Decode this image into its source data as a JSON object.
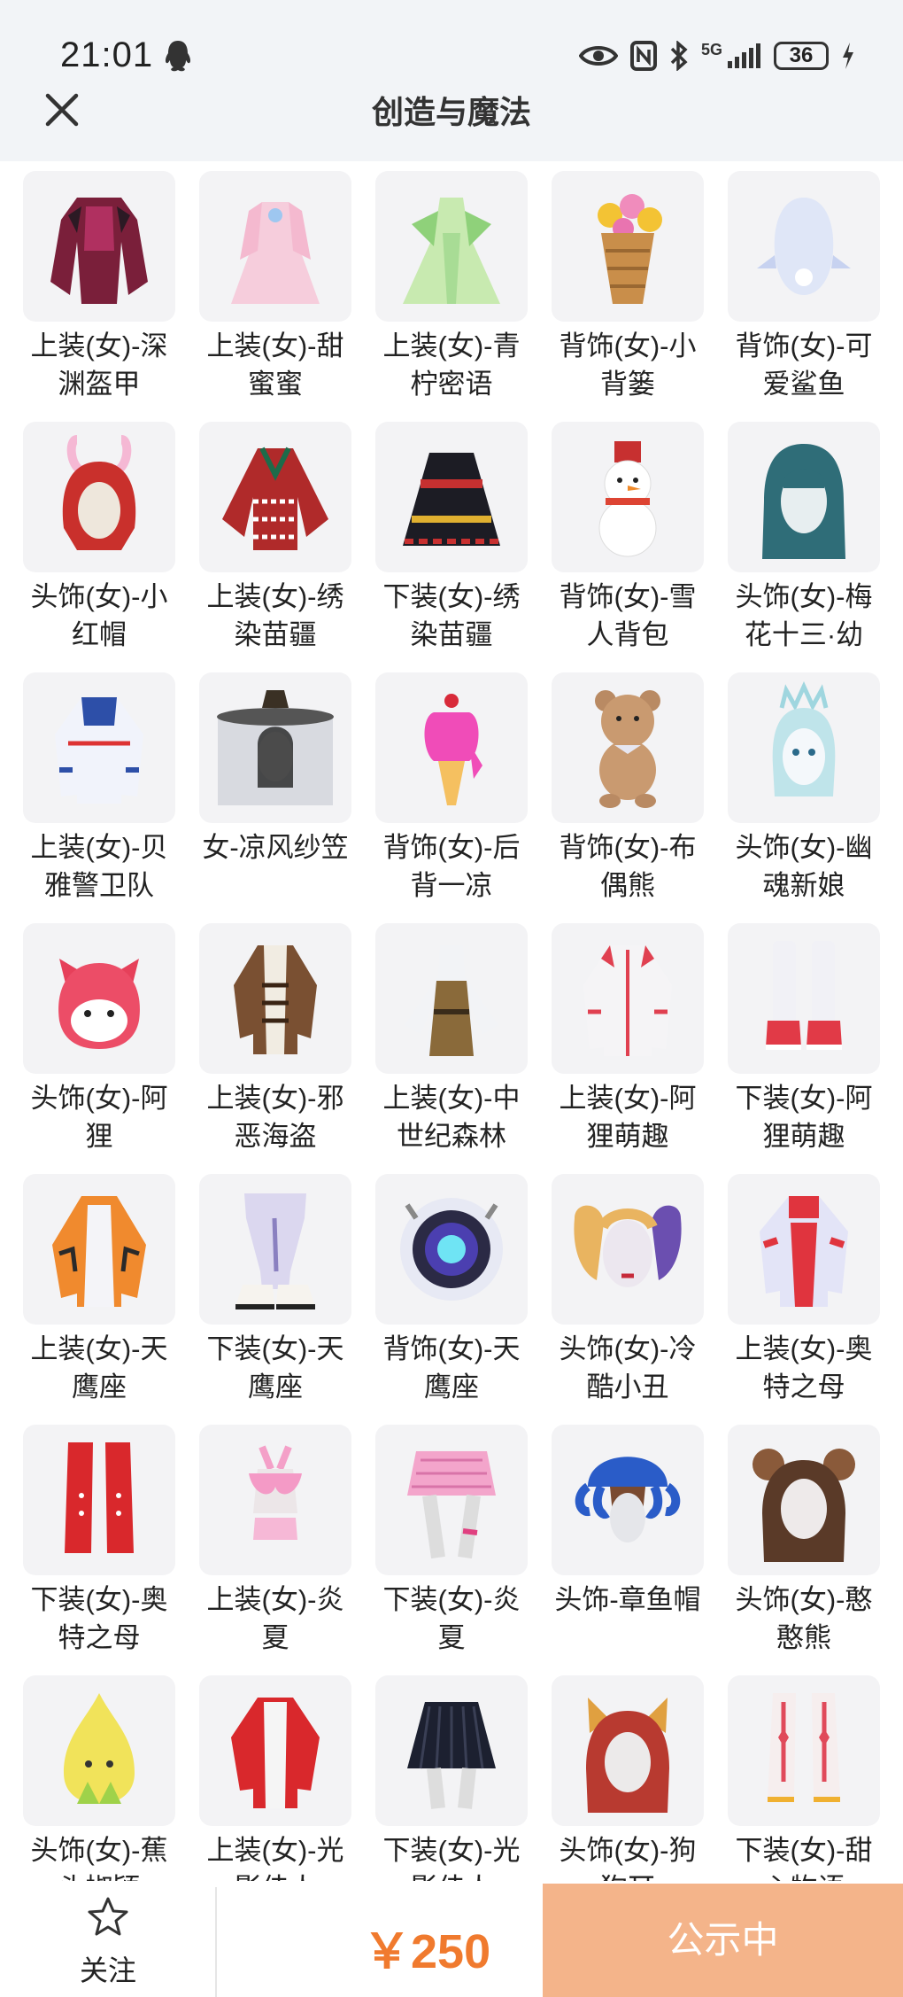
{
  "status_bar": {
    "time": "21:01",
    "network": "5G",
    "battery": "36"
  },
  "header": {
    "title": "创造与魔法"
  },
  "items": [
    {
      "label": "上装(女)-深渊盔甲",
      "icon": "dark-armor-top-thumb"
    },
    {
      "label": "上装(女)-甜蜜蜜",
      "icon": "pink-dress-top-thumb"
    },
    {
      "label": "上装(女)-青柠密语",
      "icon": "green-dress-top-thumb"
    },
    {
      "label": "背饰(女)-小背篓",
      "icon": "flower-basket-thumb"
    },
    {
      "label": "背饰(女)-可爱鲨鱼",
      "icon": "shark-backpack-thumb"
    },
    {
      "label": "头饰(女)-小红帽",
      "icon": "red-hood-thumb"
    },
    {
      "label": "上装(女)-绣染苗疆",
      "icon": "embroidered-top-thumb"
    },
    {
      "label": "下装(女)-绣染苗疆",
      "icon": "embroidered-skirt-thumb"
    },
    {
      "label": "背饰(女)-雪人背包",
      "icon": "snowman-backpack-thumb"
    },
    {
      "label": "头饰(女)-梅花十三·幼",
      "icon": "teal-hair-thumb"
    },
    {
      "label": "上装(女)-贝雅警卫队",
      "icon": "guard-jacket-thumb"
    },
    {
      "label": "女-凉风纱笠",
      "icon": "veil-hat-thumb"
    },
    {
      "label": "背饰(女)-后背一凉",
      "icon": "ice-cream-thumb"
    },
    {
      "label": "背饰(女)-布偶熊",
      "icon": "teddy-bear-thumb"
    },
    {
      "label": "头饰(女)-幽魂新娘",
      "icon": "ghost-bride-thumb"
    },
    {
      "label": "头饰(女)-阿狸",
      "icon": "ali-fox-head-thumb"
    },
    {
      "label": "上装(女)-邪恶海盗",
      "icon": "pirate-top-thumb"
    },
    {
      "label": "上装(女)-中世纪森林",
      "icon": "medieval-top-thumb"
    },
    {
      "label": "上装(女)-阿狸萌趣",
      "icon": "ali-hoodie-thumb"
    },
    {
      "label": "下装(女)-阿狸萌趣",
      "icon": "ali-boots-thumb"
    },
    {
      "label": "上装(女)-天鹰座",
      "icon": "aquila-jacket-thumb"
    },
    {
      "label": "下装(女)-天鹰座",
      "icon": "aquila-pants-thumb"
    },
    {
      "label": "背饰(女)-天鹰座",
      "icon": "aquila-backpack-thumb"
    },
    {
      "label": "头饰(女)-冷酷小丑",
      "icon": "clown-hair-thumb"
    },
    {
      "label": "上装(女)-奥特之母",
      "icon": "ultra-mother-top-thumb"
    },
    {
      "label": "下装(女)-奥特之母",
      "icon": "ultra-mother-boots-thumb"
    },
    {
      "label": "上装(女)-炎夏",
      "icon": "summer-top-thumb"
    },
    {
      "label": "下装(女)-炎夏",
      "icon": "summer-skirt-thumb"
    },
    {
      "label": "头饰-章鱼帽",
      "icon": "octopus-hat-thumb"
    },
    {
      "label": "头饰(女)-憨憨熊",
      "icon": "bear-ears-hair-thumb"
    },
    {
      "label": "头饰(女)-蕉头椒颖",
      "icon": "banana-hat-thumb"
    },
    {
      "label": "上装(女)-光影佳人",
      "icon": "red-jacket-thumb"
    },
    {
      "label": "下装(女)-光影佳人",
      "icon": "black-skirt-thumb"
    },
    {
      "label": "头饰(女)-狗狗耳",
      "icon": "dog-ears-hair-thumb"
    },
    {
      "label": "下装(女)-甜心物语",
      "icon": "sweetheart-boots-thumb"
    }
  ],
  "bottom_bar": {
    "follow_label": "关注",
    "price": "￥250",
    "status_label": "公示中"
  },
  "colors": {
    "price": "#f07a2e",
    "status_button": "#f4b48a",
    "header_bg": "#f2f4f7",
    "tile_bg": "#f3f3f5"
  }
}
